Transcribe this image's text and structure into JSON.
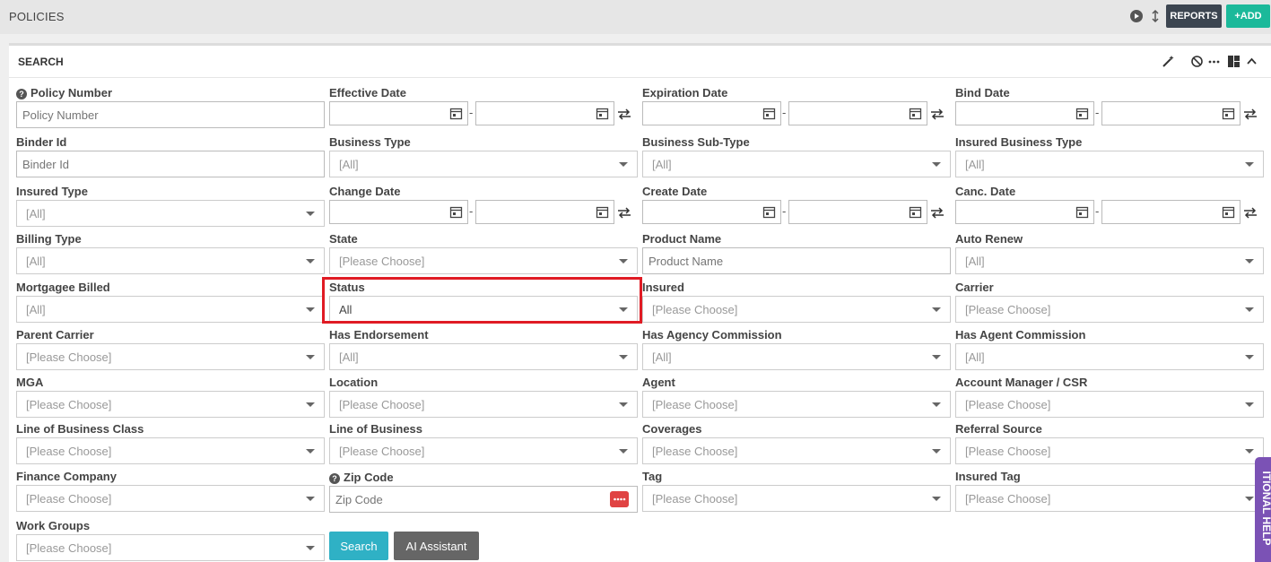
{
  "topbar": {
    "title": "POLICIES",
    "reports_label": "REPORTS",
    "add_label": "+ADD"
  },
  "panel": {
    "title": "SEARCH"
  },
  "fields": {
    "policy_number": {
      "label": "Policy Number",
      "placeholder": "Policy Number"
    },
    "effective_date": {
      "label": "Effective Date"
    },
    "expiration_date": {
      "label": "Expiration Date"
    },
    "bind_date": {
      "label": "Bind Date"
    },
    "binder_id": {
      "label": "Binder Id",
      "placeholder": "Binder Id"
    },
    "business_type": {
      "label": "Business Type",
      "value": "[All]"
    },
    "business_sub_type": {
      "label": "Business Sub-Type",
      "value": "[All]"
    },
    "insured_business_type": {
      "label": "Insured Business Type",
      "value": "[All]"
    },
    "insured_type": {
      "label": "Insured Type",
      "value": "[All]"
    },
    "change_date": {
      "label": "Change Date"
    },
    "create_date": {
      "label": "Create Date"
    },
    "canc_date": {
      "label": "Canc. Date"
    },
    "billing_type": {
      "label": "Billing Type",
      "value": "[All]"
    },
    "state": {
      "label": "State",
      "value": "[Please Choose]"
    },
    "product_name": {
      "label": "Product Name",
      "placeholder": "Product Name"
    },
    "auto_renew": {
      "label": "Auto Renew",
      "value": "[All]"
    },
    "mortgagee_billed": {
      "label": "Mortgagee Billed",
      "value": "[All]"
    },
    "status": {
      "label": "Status",
      "value": "All"
    },
    "insured": {
      "label": "Insured",
      "value": "[Please Choose]"
    },
    "carrier": {
      "label": "Carrier",
      "value": "[Please Choose]"
    },
    "parent_carrier": {
      "label": "Parent Carrier",
      "value": "[Please Choose]"
    },
    "has_endorsement": {
      "label": "Has Endorsement",
      "value": "[All]"
    },
    "has_agency_commission": {
      "label": "Has Agency Commission",
      "value": "[All]"
    },
    "has_agent_commission": {
      "label": "Has Agent Commission",
      "value": "[All]"
    },
    "mga": {
      "label": "MGA",
      "value": "[Please Choose]"
    },
    "location": {
      "label": "Location",
      "value": "[Please Choose]"
    },
    "agent": {
      "label": "Agent",
      "value": "[Please Choose]"
    },
    "account_manager": {
      "label": "Account Manager / CSR",
      "value": "[Please Choose]"
    },
    "lob_class": {
      "label": "Line of Business Class",
      "value": "[Please Choose]"
    },
    "lob": {
      "label": "Line of Business",
      "value": "[Please Choose]"
    },
    "coverages": {
      "label": "Coverages",
      "value": "[Please Choose]"
    },
    "referral_source": {
      "label": "Referral Source",
      "value": "[Please Choose]"
    },
    "finance_company": {
      "label": "Finance Company",
      "value": "[Please Choose]"
    },
    "zip_code": {
      "label": "Zip Code",
      "placeholder": "Zip Code"
    },
    "tag": {
      "label": "Tag",
      "value": "[Please Choose]"
    },
    "insured_tag": {
      "label": "Insured Tag",
      "value": "[Please Choose]"
    },
    "work_groups": {
      "label": "Work Groups",
      "value": "[Please Choose]"
    }
  },
  "actions": {
    "search_label": "Search",
    "ai_label": "AI Assistant"
  },
  "help_tab": {
    "label": "ITIONAL HELP"
  },
  "colors": {
    "accent_teal": "#2fb1c5",
    "add_green": "#1bb99a",
    "highlight_red": "#e01b24",
    "help_purple": "#7b52b5"
  }
}
